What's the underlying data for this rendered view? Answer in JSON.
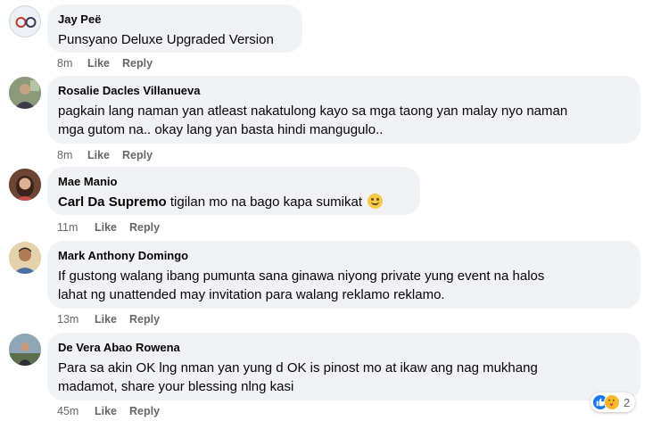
{
  "comments": [
    {
      "name": "Jay Peë",
      "text": "Punsyano Deluxe Upgraded Version",
      "time": "8m",
      "like": "Like",
      "reply": "Reply"
    },
    {
      "name": "Rosalie Dacles Villanueva",
      "text_line1": "pagkain lang naman yan atleast nakatulong kayo sa mga taong yan malay nyo naman",
      "text_line2": "mga gutom na.. okay lang yan basta hindi mangugulo..",
      "time": "8m",
      "like": "Like",
      "reply": "Reply"
    },
    {
      "name": "Mae Manio",
      "mention": "Carl Da Supremo",
      "text": " tigilan mo na bago kapa sumikat ",
      "emoji": "grinning-emoji",
      "time": "11m",
      "like": "Like",
      "reply": "Reply"
    },
    {
      "name": "Mark Anthony Domingo",
      "text_line1": "If gustong walang ibang pumunta sana ginawa niyong private yung event na halos",
      "text_line2": "lahat ng unattended may invitation para walang reklamo reklamo.",
      "time": "13m",
      "like": "Like",
      "reply": "Reply"
    },
    {
      "name": "De Vera Abao Rowena",
      "text_line1": "Para sa akin OK lng nman yan yung d OK is pinost mo at ikaw ang nag mukhang",
      "text_line2": "madamot, share your blessing nlng kasi",
      "time": "45m",
      "like": "Like",
      "reply": "Reply",
      "reactions": {
        "icons": [
          "like-reaction-icon",
          "care-reaction-icon"
        ],
        "count": "2"
      }
    }
  ],
  "colors": {
    "bubble": "#f0f2f5",
    "meta": "#65676b",
    "text": "#050505",
    "like_blue": "#1877f2"
  }
}
